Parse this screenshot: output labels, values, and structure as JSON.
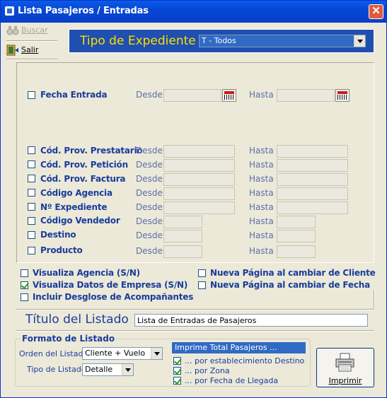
{
  "window": {
    "title": "Lista Pasajeros / Entradas"
  },
  "toolbar": {
    "buscar_label": "Buscar",
    "salir_label": "Salir"
  },
  "tipo_expediente": {
    "label": "Tipo de Expediente",
    "value": "T - Todos"
  },
  "filters": {
    "fecha_entrada": {
      "label": "Fecha Entrada",
      "desde": "Desde",
      "hasta": "Hasta"
    },
    "rows": [
      {
        "label": "Cód. Prov. Prestatario",
        "desde": "Desde",
        "hasta": "Hasta"
      },
      {
        "label": "Cód. Prov. Petición",
        "desde": "Desde",
        "hasta": "Hasta"
      },
      {
        "label": "Cód. Prov. Factura",
        "desde": "Desde",
        "hasta": "Hasta"
      },
      {
        "label": "Código Agencia",
        "desde": "Desde",
        "hasta": "Hasta"
      },
      {
        "label": "Nº Expediente",
        "desde": "Desde",
        "hasta": "Hasta"
      },
      {
        "label": "Código Vendedor",
        "desde": "Desde",
        "hasta": "Hasta"
      },
      {
        "label": "Destino",
        "desde": "Desde",
        "hasta": "Hasta"
      },
      {
        "label": "Producto",
        "desde": "Desde",
        "hasta": "Hasta"
      }
    ]
  },
  "options": {
    "visualiza_agencia": {
      "label": "Visualiza Agencia (S/N)",
      "checked": false
    },
    "visualiza_empresa": {
      "label": "Visualiza Datos de Empresa (S/N)",
      "checked": true
    },
    "incluir_desglose": {
      "label": "Incluir Desglose de Acompañantes",
      "checked": false
    },
    "nueva_pagina_cliente": {
      "label": "Nueva Página al cambiar de Cliente",
      "checked": false
    },
    "nueva_pagina_fecha": {
      "label": "Nueva Página al cambiar de Fecha",
      "checked": false
    }
  },
  "titulo": {
    "label": "Título del Listado",
    "value": "Lista de Entradas de Pasajeros"
  },
  "formato": {
    "legend": "Formato de Listado",
    "orden_label": "Orden del Listado",
    "orden_value": "Cliente + Vuelo",
    "tipo_label": "Tipo de Listado",
    "tipo_value": "Detalle"
  },
  "imprime_total": {
    "header": "Imprime Total Pasajeros ...",
    "items": [
      {
        "label": "... por establecimiento Destino",
        "checked": true
      },
      {
        "label": "... por Zona",
        "checked": true
      },
      {
        "label": "... por Fecha de Llegada",
        "checked": true
      }
    ]
  },
  "print_button": {
    "label": "Imprimir"
  }
}
